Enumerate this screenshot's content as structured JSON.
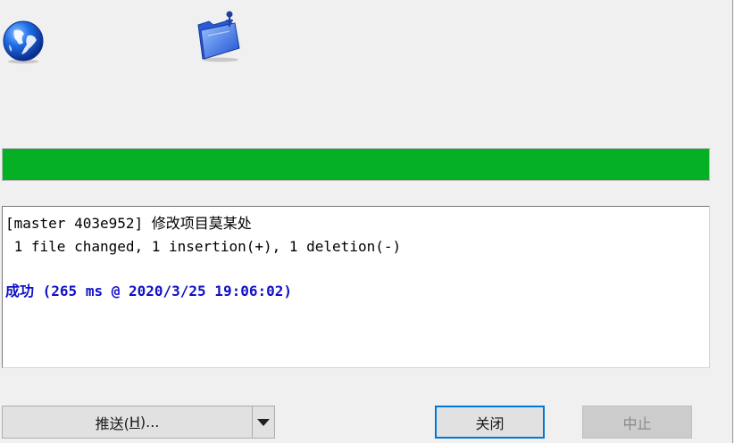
{
  "icons": {
    "status_icon": "globe-icon",
    "repo_icon": "folder-icon"
  },
  "progress": {
    "value": 1.0,
    "color": "#06b025"
  },
  "log": {
    "line1": "[master 403e952] 修改项目莫某处",
    "line2": " 1 file changed, 1 insertion(+), 1 deletion(-)",
    "success_label": "成功",
    "success_detail": " (265 ms @ 2020/3/25 19:06:02)",
    "success_color": "#1010c8"
  },
  "buttons": {
    "push_prefix": "推送(",
    "push_mnemonic": "H",
    "push_suffix": ")...",
    "close": "关闭",
    "abort": "中止"
  }
}
